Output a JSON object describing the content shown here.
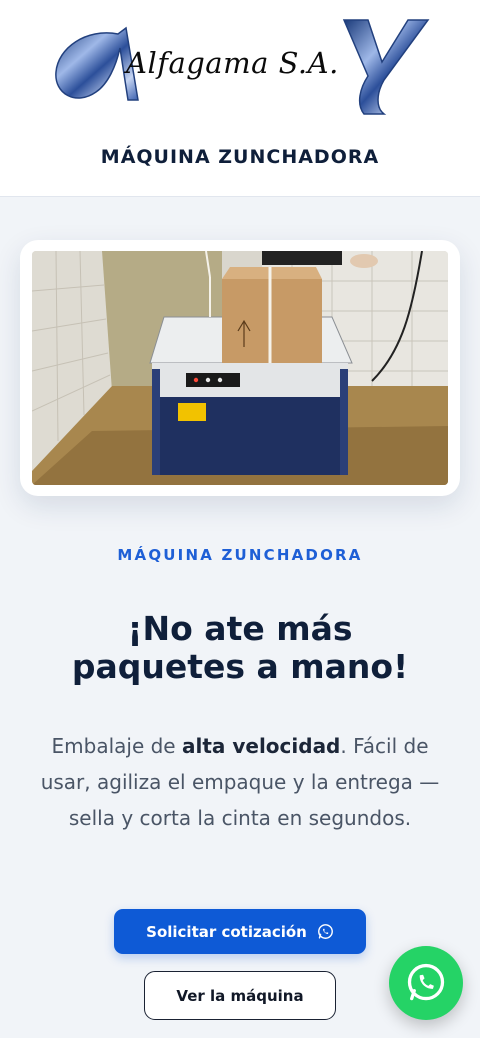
{
  "header": {
    "logo_text": "Alfagama S.A.",
    "title": "MÁQUINA ZUNCHADORA"
  },
  "hero": {
    "image_icon": "strapping-machine-photo",
    "eyebrow": "MÁQUINA ZUNCHADORA",
    "headline": "¡No ate más paquetes a mano!",
    "description": {
      "before": "Embalaje de ",
      "bold": "alta velocidad",
      "after": ". Fácil de usar, agiliza el empaque y la entrega — sella y corta la cinta en segundos."
    }
  },
  "buttons": {
    "quote_label": "Solicitar cotización",
    "quote_icon": "whatsapp-icon",
    "view_label": "Ver la máquina"
  },
  "floating": {
    "icon": "whatsapp-icon"
  },
  "colors": {
    "accent": "#1e5fd6",
    "button_primary": "#0e5ad6",
    "heading": "#0f1f3a",
    "whatsapp": "#25d366",
    "background": "#f1f4f8"
  }
}
